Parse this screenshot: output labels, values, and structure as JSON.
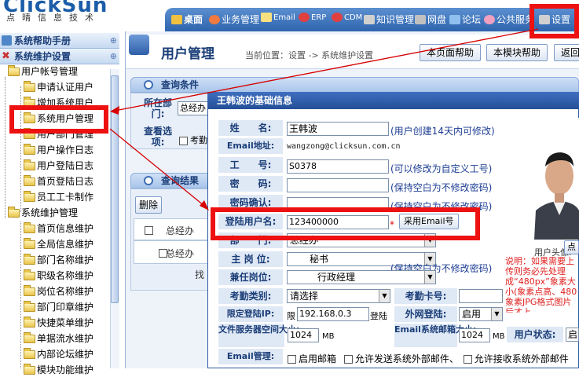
{
  "header": {
    "logo": "ClickSun",
    "logo_sub": "点晴信息技术",
    "nav": [
      {
        "label": "桌面",
        "icon": "desktop-icon",
        "color": "#f0c040"
      },
      {
        "label": "业务管理",
        "icon": "user-icon",
        "color": "#f07a40"
      },
      {
        "label": "Email",
        "icon": "email-icon",
        "color": "#f8e080"
      },
      {
        "label": "ERP",
        "icon": "globe-icon",
        "color": "#e04040"
      },
      {
        "label": "CDM",
        "icon": "globe-icon",
        "color": "#e04040"
      },
      {
        "label": "知识管理",
        "icon": "knowledge-icon",
        "color": "#d0d0d0"
      },
      {
        "label": "网盘",
        "icon": "disk-icon",
        "color": "#c0c0c0"
      },
      {
        "label": "论坛",
        "icon": "forum-icon",
        "color": "#90c0f0"
      },
      {
        "label": "公共服务",
        "icon": "flower-icon",
        "color": "#f0a0c0"
      },
      {
        "label": "设置",
        "icon": "tools-icon",
        "color": "#d0d0d0"
      }
    ]
  },
  "sidebar": {
    "help_header": "系统帮助手册",
    "maint_header": "系统维护设置",
    "items": [
      {
        "label": "用户帐号管理",
        "level": 0
      },
      {
        "label": "申请认证用户",
        "level": 1
      },
      {
        "label": "增加系统用户",
        "level": 1
      },
      {
        "label": "系统用户管理",
        "level": 1
      },
      {
        "label": "用户部门管理",
        "level": 1
      },
      {
        "label": "用户操作日志",
        "level": 1
      },
      {
        "label": "用户登陆日志",
        "level": 1
      },
      {
        "label": "首页登陆日志",
        "level": 1
      },
      {
        "label": "员工工卡制作",
        "level": 1
      },
      {
        "label": "系统维护管理",
        "level": 0
      },
      {
        "label": "首页信息维护",
        "level": 1
      },
      {
        "label": "全局信息维护",
        "level": 1
      },
      {
        "label": "部门名称维护",
        "level": 1
      },
      {
        "label": "职级名称维护",
        "level": 1
      },
      {
        "label": "岗位名称维护",
        "level": 1
      },
      {
        "label": "部门印章维护",
        "level": 1
      },
      {
        "label": "快捷菜单维护",
        "level": 1
      },
      {
        "label": "单据流水维护",
        "level": 1
      },
      {
        "label": "内部论坛维护",
        "level": 1
      },
      {
        "label": "模块功能维护",
        "level": 1
      }
    ]
  },
  "main": {
    "title": "用户管理",
    "breadcrumb": "当前位置：设置 -> 系统维护设置",
    "buttons": [
      "本页面帮助",
      "本模块帮助",
      "返回"
    ],
    "query_panel": "查询条件",
    "dept_label": "所在部门:",
    "dept_value": "总经办",
    "options_label": "查看选项:",
    "options_value": "考勤",
    "result_panel": "查询结果",
    "delete_button": "删除",
    "rows": [
      "总经办",
      "总经办"
    ],
    "pager": "找"
  },
  "dialog": {
    "title": "王韩波的基础信息",
    "name_label": "姓　　名:",
    "name_value": "王韩波",
    "name_hint": "(用户创建14天内可修改)",
    "email_label": "Email地址:",
    "email_value": "wangzong@clicksun.com.cn",
    "empno_label": "工　　号:",
    "empno_value": "S0378",
    "empno_hint": "(可以修改为自定义工号)",
    "pwd_label": "密　　码:",
    "pwd_hint": "(保持空白为不修改密码)",
    "pwd2_label": "密码确认:",
    "pwd2_hint": "(保持空白为不修改密码)",
    "login_label": "登陆用户名:",
    "login_value": "123400000",
    "login_btn": "采用Email号",
    "dept_label": "部　　门:",
    "dept_value": "总经办",
    "post_label": "主 岗 位:",
    "post_value": "秘书",
    "concurrent_label": "兼任岗位:",
    "concurrent_value": "行政经理",
    "attend_label": "考勤类别:",
    "attend_value": "请选择",
    "card_label": "考勤卡号:",
    "ip_label": "限定登陆IP:",
    "ip_prefix": "限",
    "ip_value": "192.168.0.3",
    "ip_suffix": "登陆",
    "external_label": "外网登陆:",
    "external_value": "启用",
    "space_label": "文件服务器空间大小:",
    "space_value": "1024",
    "space_unit": "MB",
    "mailbox_label": "Email系统邮箱大小:",
    "mailbox_value": "1024",
    "mailbox_unit": "MB",
    "status_label": "用户状态:",
    "status_value": "启",
    "email_mgmt_label": "Email管理:",
    "email_opt1": "启用邮箱",
    "email_opt2": "允许发送系统外部邮件、",
    "email_opt3": "允许接收系统外部邮件",
    "avatar_label": "用户头像:",
    "avatar_btn": "点",
    "note": "说明：如果需要上传则务必先处理成“480px”象素大小(象素点高、480象素JPG格式图片后才上"
  }
}
